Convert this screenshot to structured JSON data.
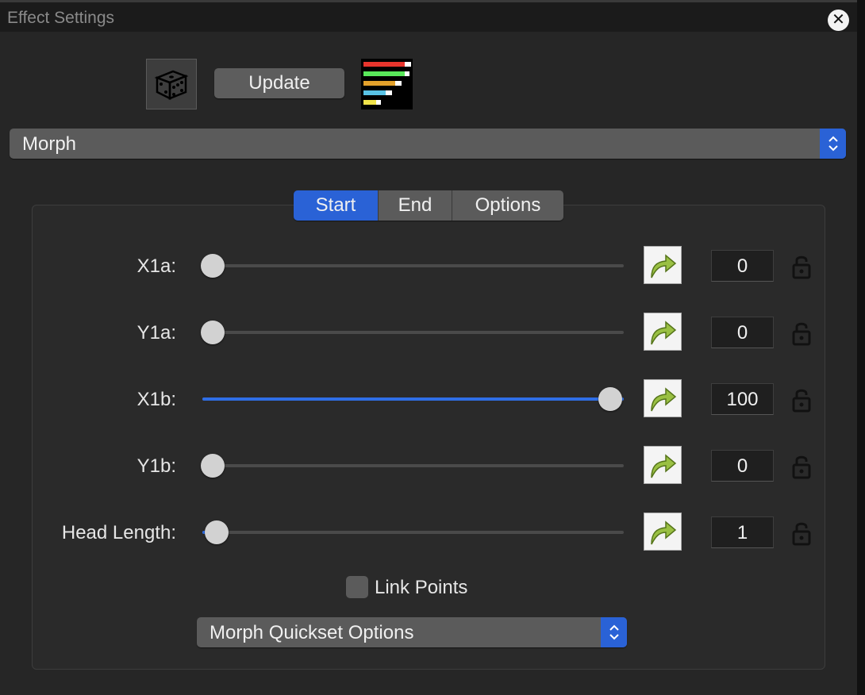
{
  "window": {
    "title": "Effect Settings"
  },
  "toolbar": {
    "update_label": "Update"
  },
  "effect_select": {
    "value": "Morph"
  },
  "tabs": [
    {
      "label": "Start",
      "active": true
    },
    {
      "label": "End",
      "active": false
    },
    {
      "label": "Options",
      "active": false
    }
  ],
  "rows": [
    {
      "label": "X1a:",
      "value": "0",
      "slider_fraction": 0.0
    },
    {
      "label": "Y1a:",
      "value": "0",
      "slider_fraction": 0.0
    },
    {
      "label": "X1b:",
      "value": "100",
      "slider_fraction": 1.0
    },
    {
      "label": "Y1b:",
      "value": "0",
      "slider_fraction": 0.0
    },
    {
      "label": "Head Length:",
      "value": "1",
      "slider_fraction": 0.01
    }
  ],
  "link_points": {
    "label": "Link Points",
    "checked": false
  },
  "quickset": {
    "value": "Morph Quickset Options"
  },
  "colors": {
    "accent": "#2a62d6",
    "slider_fill": "#2f6ee6",
    "bars": [
      "#e8352d",
      "#59e85a",
      "#e3a12b",
      "#59c3e6",
      "#f0e34a"
    ]
  }
}
